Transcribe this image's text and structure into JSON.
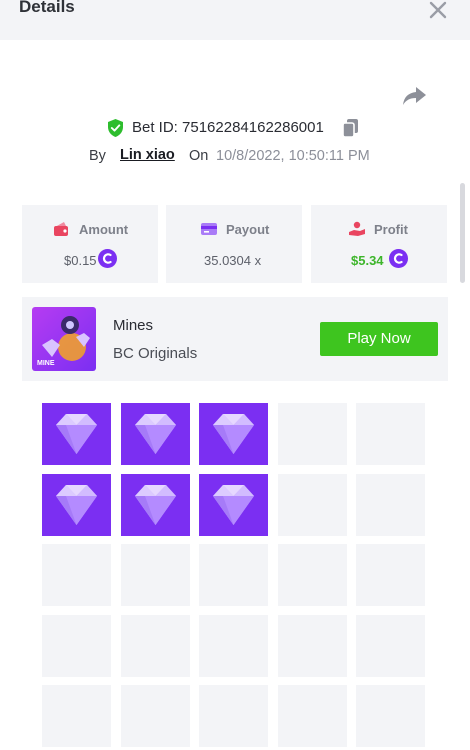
{
  "header": {
    "title": "Details"
  },
  "bet": {
    "id_text": "Bet ID: 75162284162286001",
    "by_label": "By",
    "user": "Lin xiao",
    "on_label": "On",
    "timestamp": "10/8/2022, 10:50:11 PM"
  },
  "stats": {
    "amount": {
      "label": "Amount",
      "value": "$0.15",
      "icon": "wallet-icon"
    },
    "payout": {
      "label": "Payout",
      "value": "35.0304 x",
      "icon": "card-icon"
    },
    "profit": {
      "label": "Profit",
      "value": "$5.34",
      "icon": "profit-hand-icon"
    }
  },
  "game": {
    "name": "Mines",
    "provider": "BC Originals",
    "thumb_text": "MINE",
    "play_label": "Play Now"
  },
  "board": {
    "columns": 5,
    "rows": 5,
    "cells": [
      "gem",
      "gem",
      "gem",
      "hidden",
      "hidden",
      "gem",
      "gem",
      "gem",
      "hidden",
      "hidden",
      "hidden",
      "hidden",
      "hidden",
      "hidden",
      "hidden",
      "hidden",
      "hidden",
      "hidden",
      "hidden",
      "hidden",
      "hidden",
      "hidden",
      "hidden",
      "hidden",
      "hidden"
    ]
  },
  "colors": {
    "accent_purple": "#7b2ff2",
    "play_green": "#3ec51f",
    "profit_green": "#3db52b",
    "shield_green": "#2ebd2e",
    "icon_red": "#e94560",
    "panel_bg": "#f3f4f7"
  }
}
